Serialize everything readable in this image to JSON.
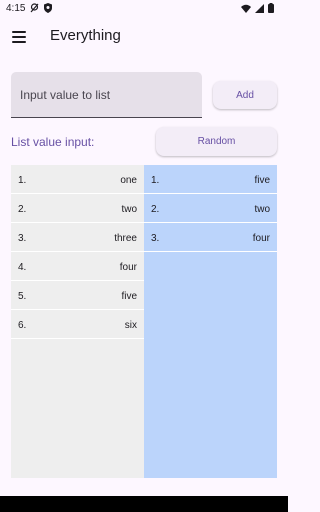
{
  "status_bar": {
    "time": "4:15",
    "left_icons": [
      "location-off-icon",
      "shield-icon"
    ],
    "right_icons": [
      "wifi-icon",
      "signal-icon",
      "battery-icon"
    ]
  },
  "app_bar": {
    "title": "Everything",
    "menu_icon": "hamburger-menu-icon"
  },
  "input": {
    "placeholder": "Input value to list",
    "value": ""
  },
  "buttons": {
    "add_label": "Add",
    "random_label": "Random"
  },
  "list_label": "List value input:",
  "left_list": [
    {
      "index": "1.",
      "value": "one"
    },
    {
      "index": "2.",
      "value": "two"
    },
    {
      "index": "3.",
      "value": "three"
    },
    {
      "index": "4.",
      "value": "four"
    },
    {
      "index": "5.",
      "value": "five"
    },
    {
      "index": "6.",
      "value": "six"
    }
  ],
  "right_list": [
    {
      "index": "1.",
      "value": "five"
    },
    {
      "index": "2.",
      "value": "two"
    },
    {
      "index": "3.",
      "value": "four"
    }
  ],
  "colors": {
    "background": "#fdf7ff",
    "accent": "#6750a4",
    "input_fill": "#e6e0e9",
    "left_list_bg": "#eeeeee",
    "right_list_bg": "#bbd4fb"
  }
}
